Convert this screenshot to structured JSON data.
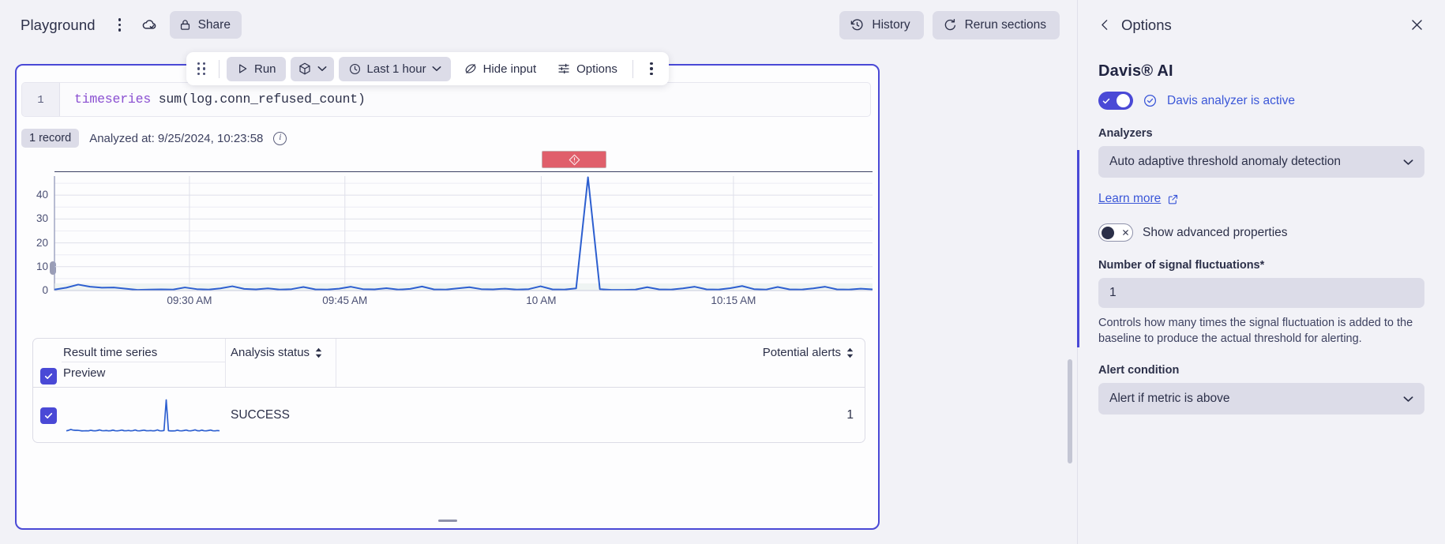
{
  "header": {
    "title": "Playground",
    "kebab_label": "More actions",
    "cloud_icon": "cloud-check-icon",
    "share_label": "Share",
    "history_label": "History",
    "rerun_label": "Rerun sections"
  },
  "toolbar": {
    "run_label": "Run",
    "cube_label": "Visualization type",
    "timeframe_label": "Last 1 hour",
    "hide_input_label": "Hide input",
    "options_label": "Options",
    "kebab_label": "More"
  },
  "editor": {
    "line_number": "1",
    "keyword": "timeseries",
    "expression": " sum(log.conn_refused_count)"
  },
  "status": {
    "record_badge": "1 record",
    "analyzed_at": "Analyzed at: 9/25/2024, 10:23:58",
    "info_glyph": "i"
  },
  "chart_data": {
    "type": "line",
    "title": "",
    "xlabel": "",
    "ylabel": "",
    "ylim": [
      0,
      48
    ],
    "yticks": [
      0,
      10,
      20,
      30,
      40
    ],
    "xticks": [
      "09:30 AM",
      "09:45 AM",
      "10 AM",
      "10:15 AM"
    ],
    "grid": true,
    "line_color": "#2d5fd0",
    "anomaly_band": {
      "label": "",
      "color": "#e05f6b",
      "icon": "alert-diamond-icon",
      "start": "09:57 AM",
      "end": "10:03 AM"
    },
    "series": [
      {
        "name": "sum(log.conn_refused_count)",
        "values": [
          0.4,
          1.2,
          2.5,
          1.6,
          1.2,
          1.3,
          0.8,
          0.3,
          0.4,
          0.5,
          0.4,
          1.3,
          0.6,
          0.4,
          0.9,
          1.8,
          0.7,
          0.5,
          0.9,
          0.4,
          0.6,
          1.5,
          0.5,
          0.4,
          0.8,
          1.6,
          0.6,
          0.5,
          1.0,
          0.4,
          0.7,
          1.7,
          0.5,
          0.4,
          0.9,
          1.4,
          0.6,
          0.5,
          0.8,
          0.4,
          0.6,
          1.8,
          0.5,
          0.4,
          0.9,
          47.5,
          0.6,
          0.3,
          0.3,
          0.4,
          1.4,
          0.5,
          0.4,
          0.9,
          1.6,
          0.5,
          0.4,
          1.0,
          1.9,
          0.6,
          0.4,
          1.5,
          0.5,
          0.4,
          0.9,
          1.6,
          0.5,
          0.4,
          0.8,
          0.5
        ]
      }
    ]
  },
  "results_table": {
    "columns": {
      "result_time_series": "Result time series",
      "preview": "Preview",
      "analysis_status": "Analysis status",
      "potential_alerts": "Potential alerts"
    },
    "rows": [
      {
        "selected": true,
        "analysis_status": "SUCCESS",
        "potential_alerts": "1"
      }
    ]
  },
  "options_panel": {
    "back_icon": "chevron-left-icon",
    "title": "Options",
    "close_icon": "close-icon",
    "section_title": "Davis® AI",
    "davis_toggle_on": true,
    "davis_status": "Davis analyzer is active",
    "analyzers_label": "Analyzers",
    "analyzer_selected": "Auto adaptive threshold anomaly detection",
    "learn_more": "Learn more",
    "advanced_toggle_on": false,
    "advanced_label": "Show advanced properties",
    "fluctuations_label": "Number of signal fluctuations*",
    "fluctuations_value": "1",
    "fluctuations_help": "Controls how many times the signal fluctuation is added to the baseline to produce the actual threshold for alerting.",
    "alert_condition_label": "Alert condition",
    "alert_condition_value": "Alert if metric is above"
  },
  "colors": {
    "accent": "#4a49d6",
    "link": "#3b57d8",
    "alert": "#e05f6b",
    "chart_line": "#2d5fd0"
  }
}
